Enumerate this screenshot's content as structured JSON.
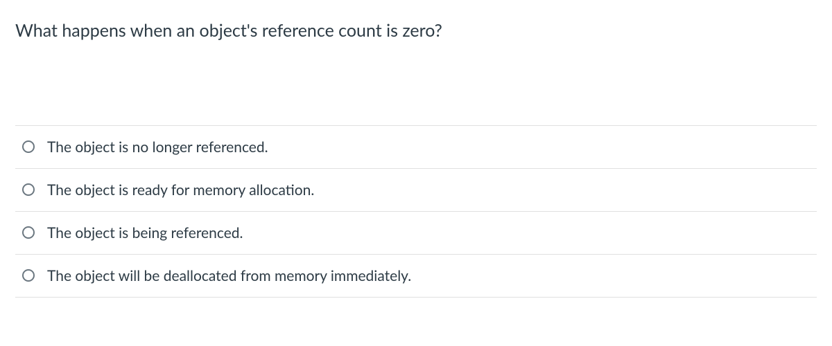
{
  "question": {
    "text": "What happens when an object's reference count is zero?",
    "options": [
      {
        "label": "The object is no longer referenced."
      },
      {
        "label": "The object is ready for memory allocation."
      },
      {
        "label": "The object is being referenced."
      },
      {
        "label": "The object will be deallocated from memory immediately."
      }
    ]
  }
}
